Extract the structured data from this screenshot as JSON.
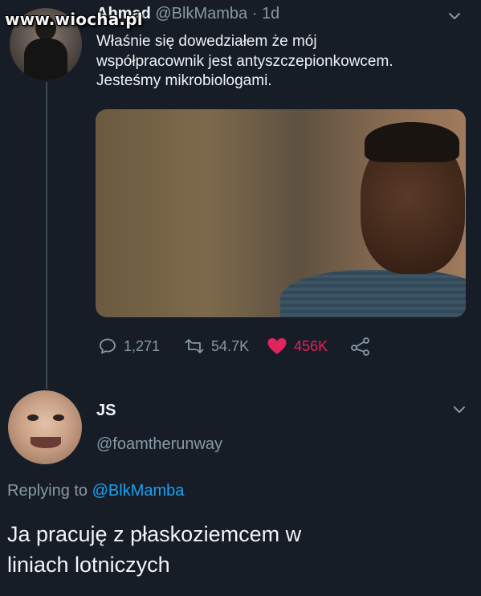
{
  "watermark": "www.wiocha.pl",
  "original_tweet": {
    "display_name": "Ahmad",
    "handle": "@BlkMamba",
    "separator": "·",
    "time": "1d",
    "text_lines": [
      "Właśnie się dowedziałem że mój",
      "współpracownik jest antyszczepionkowcem.",
      "Jesteśmy mikrobiologami."
    ],
    "actions": {
      "replies": "1,271",
      "retweets": "54.7K",
      "likes": "456K"
    }
  },
  "reply_tweet": {
    "display_name": "JS",
    "handle": "@foamtherunway",
    "replying_prefix": "Replying to",
    "replying_mention": "@BlkMamba",
    "text_lines": [
      "Ja pracuję z płaskoziemcem w",
      "liniach lotniczych"
    ]
  },
  "icons": {
    "reply": "comment-icon",
    "retweet": "retweet-icon",
    "like": "heart-icon",
    "share": "share-icon",
    "menu": "chevron-down-icon"
  },
  "colors": {
    "background": "#161d26",
    "secondary_text": "#8899a6",
    "like": "#e0245e",
    "link": "#1da1f2"
  }
}
